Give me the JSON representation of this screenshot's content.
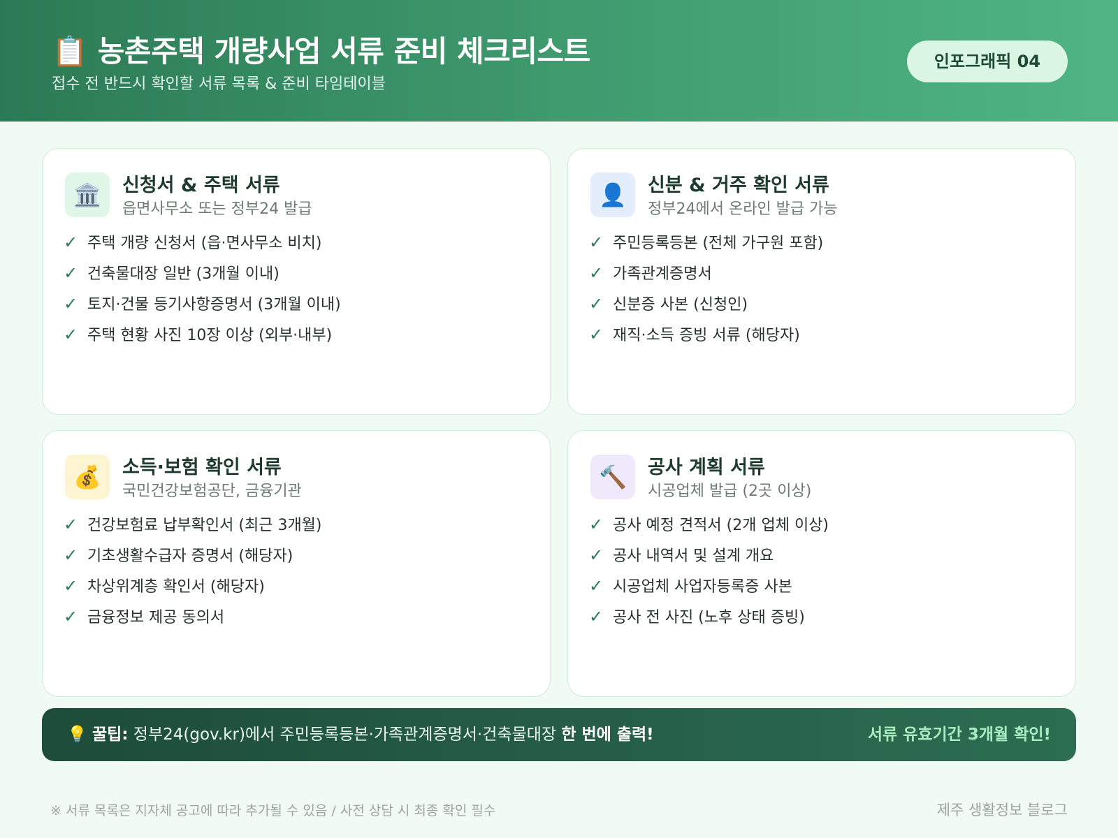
{
  "header": {
    "icon": "📋",
    "title": "농촌주택 개량사업 서류 준비 체크리스트",
    "subtitle": "접수 전 반드시 확인할 서류 목록 & 준비 타임테이블",
    "badge": "인포그래픽 04"
  },
  "cards": [
    {
      "icon": "🏛️",
      "icon_name": "bank-icon",
      "icon_bg": "#dff6e8",
      "title": "신청서 & 주택 서류",
      "subtitle": "읍면사무소 또는 정부24 발급",
      "items": [
        "주택 개량 신청서 (읍·면사무소 비치)",
        "건축물대장 일반 (3개월 이내)",
        "토지·건물 등기사항증명서 (3개월 이내)",
        "주택 현황 사진 10장 이상 (외부·내부)"
      ]
    },
    {
      "icon": "👤",
      "icon_name": "person-icon",
      "icon_bg": "#e3edfb",
      "title": "신분 & 거주 확인 서류",
      "subtitle": "정부24에서 온라인 발급 가능",
      "items": [
        "주민등록등본 (전체 가구원 포함)",
        "가족관계증명서",
        "신분증 사본 (신청인)",
        "재직·소득 증빙 서류 (해당자)"
      ]
    },
    {
      "icon": "💰",
      "icon_name": "money-bag-icon",
      "icon_bg": "#fdf4d2",
      "title": "소득·보험 확인 서류",
      "subtitle": "국민건강보험공단, 금융기관",
      "items": [
        "건강보험료 납부확인서 (최근 3개월)",
        "기초생활수급자 증명서 (해당자)",
        "차상위계층 확인서 (해당자)",
        "금융정보 제공 동의서"
      ]
    },
    {
      "icon": "🔨",
      "icon_name": "hammer-icon",
      "icon_bg": "#efe9fb",
      "title": "공사 계획 서류",
      "subtitle": "시공업체 발급 (2곳 이상)",
      "items": [
        "공사 예정 견적서 (2개 업체 이상)",
        "공사 내역서 및 설계 개요",
        "시공업체 사업자등록증 사본",
        "공사 전 사진 (노후 상태 증빙)"
      ]
    }
  ],
  "check_mark": "✓",
  "tip": {
    "icon": "💡",
    "label": "꿀팁:",
    "text": " 정부24(gov.kr)에서 주민등록등본·가족관계증명서·건축물대장 ",
    "strong": "한 번에 출력!",
    "right": "서류 유효기간 3개월 확인!"
  },
  "footer": {
    "note": "※ 서류 목록은 지자체 공고에 따라 추가될 수 있음 / 사전 상담 시 최종 확인 필수",
    "brand": "제주 생활정보 블로그"
  }
}
